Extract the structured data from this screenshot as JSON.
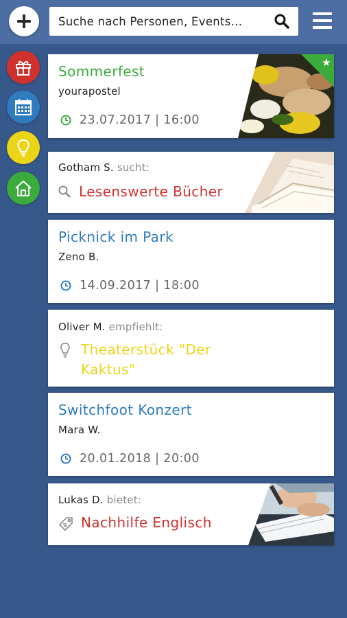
{
  "search": {
    "placeholder": "Suche nach Personen, Events..."
  },
  "sidebar": {
    "items": [
      {
        "name": "gift",
        "color": "#d0312d"
      },
      {
        "name": "calendar",
        "color": "#2f7bbf"
      },
      {
        "name": "bulb",
        "color": "#ecd418"
      },
      {
        "name": "home",
        "color": "#3bab3b"
      }
    ]
  },
  "cards": [
    {
      "title": "Sommerfest",
      "subtitle": "yourapostel",
      "date": "23.07.2017 | 16:00"
    },
    {
      "author": "Gotham S.",
      "verb": "sucht:",
      "title": "Lesenswerte Bücher"
    },
    {
      "title": "Picknick im Park",
      "subtitle": "Zeno B.",
      "date": "14.09.2017 | 18:00"
    },
    {
      "author": "Oliver M.",
      "verb": "empfiehlt:",
      "title_line1": "Theaterstück \"Der",
      "title_line2": "Kaktus\""
    },
    {
      "title": "Switchfoot Konzert",
      "subtitle": "Mara W.",
      "date": "20.01.2018 | 20:00"
    },
    {
      "author": "Lukas D.",
      "verb": "bietet:",
      "title": "Nachhilfe Englisch"
    }
  ],
  "colors": {
    "event": "#2f7bbf",
    "featured": "#3bab3b",
    "search": "#d0312d",
    "recommend": "#ecd418",
    "offer": "#d0312d"
  }
}
